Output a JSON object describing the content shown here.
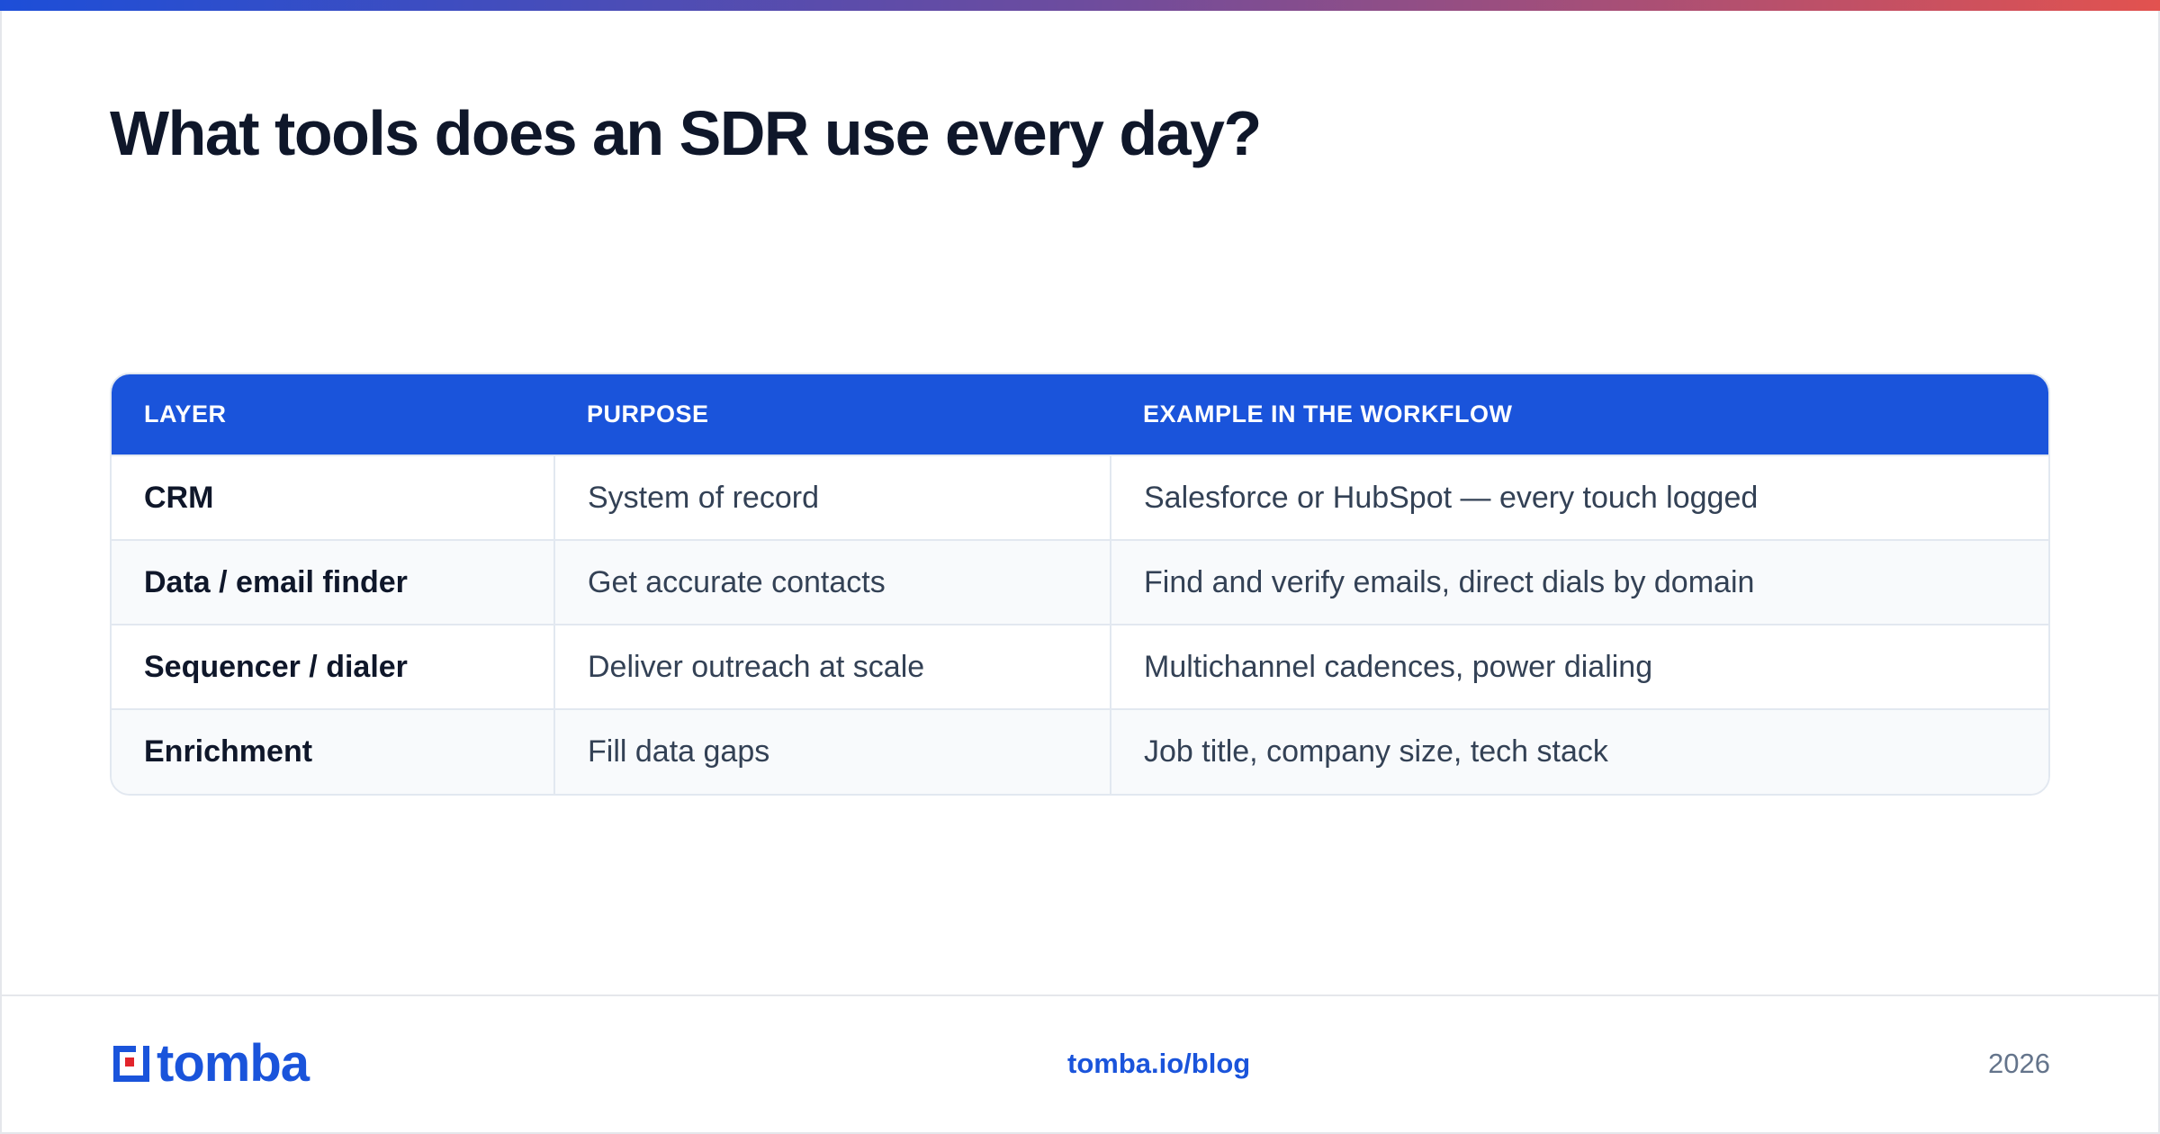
{
  "title": "What tools does an SDR use every day?",
  "colors": {
    "accent": "#1a54db",
    "heading": "#0f172a",
    "body": "#334155",
    "gradient_start": "#1d4ed8",
    "gradient_end": "#e2524f"
  },
  "table": {
    "headers": [
      "LAYER",
      "PURPOSE",
      "EXAMPLE IN THE WORKFLOW"
    ],
    "rows": [
      [
        "CRM",
        "System of record",
        "Salesforce or HubSpot — every touch logged"
      ],
      [
        "Data / email finder",
        "Get accurate contacts",
        "Find and verify emails, direct dials by domain"
      ],
      [
        "Sequencer / dialer",
        "Deliver outreach at scale",
        "Multichannel cadences, power dialing"
      ],
      [
        "Enrichment",
        "Fill data gaps",
        "Job title, company size, tech stack"
      ]
    ]
  },
  "footer": {
    "logo_text": "tomba",
    "logo_icon": "tomba-logo-icon",
    "link": "tomba.io/blog",
    "year": "2026"
  }
}
